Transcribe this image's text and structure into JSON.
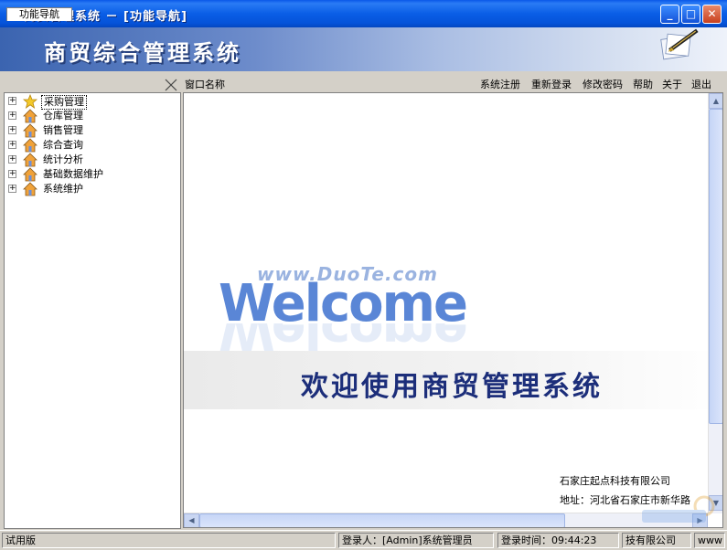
{
  "window": {
    "title": "商贸管理系统 － [功能导航]",
    "min_glyph": "_",
    "max_glyph": "□",
    "close_glyph": "✕"
  },
  "banner": {
    "system_name": "商贸综合管理系统"
  },
  "nav": {
    "tab_label": "功能导航",
    "window_name_label": "窗口名称",
    "tree": [
      {
        "label": "采购管理",
        "icon": "star-icon",
        "selected": true
      },
      {
        "label": "仓库管理",
        "icon": "house-icon"
      },
      {
        "label": "销售管理",
        "icon": "house-icon"
      },
      {
        "label": "综合查询",
        "icon": "house-icon"
      },
      {
        "label": "统计分析",
        "icon": "house-icon"
      },
      {
        "label": "基础数据维护",
        "icon": "house-icon"
      },
      {
        "label": "系统维护",
        "icon": "house-icon"
      }
    ],
    "expander_glyph": "+"
  },
  "menu": {
    "register": "系统注册",
    "relogin": "重新登录",
    "change_password": "修改密码",
    "help": "帮助",
    "about": "关于",
    "exit": "退出"
  },
  "content": {
    "welcome": "Welcome",
    "watermark": "www.DuoTe.com",
    "welcome_cn": "欢迎使用商贸管理系统",
    "company": "石家庄起点科技有限公司",
    "address": "地址：河北省石家庄市新华路"
  },
  "status": {
    "trial": "试用版",
    "login_user": "登录人：[Admin]系统管理员",
    "login_time": "登录时间：09:44:23",
    "company_tail": "技有限公司",
    "site_tail": "www"
  },
  "colors": {
    "titlebar": "#0a5ee6",
    "welcome_blue": "#5a86d6",
    "welcome_cn": "#1c2e7a"
  }
}
